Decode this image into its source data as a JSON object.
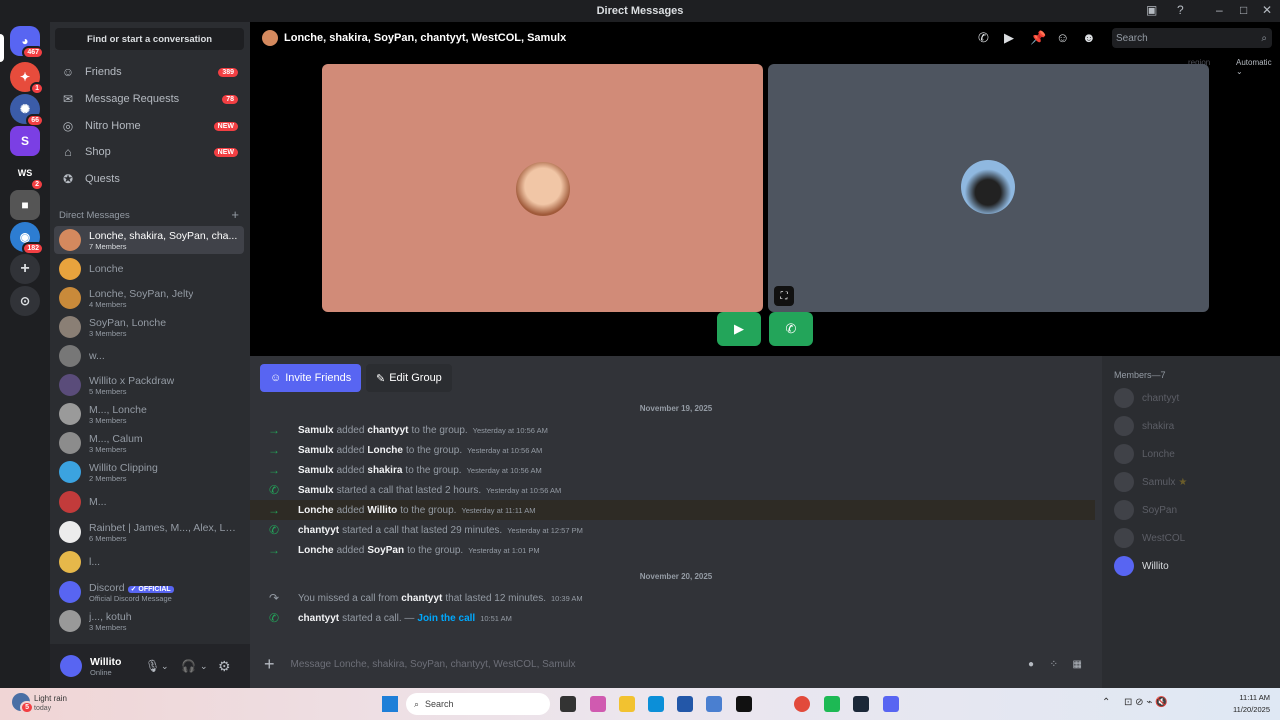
{
  "window": {
    "title": "Direct Messages"
  },
  "servers": {
    "home_badge": "467",
    "s1_badge": "1",
    "s2_badge": "66",
    "s4_label": "WS",
    "s4_badge": "2",
    "s6_badge": "182"
  },
  "sidebar": {
    "search": "Find or start a conversation",
    "nav": [
      {
        "label": "Friends",
        "badge": "389",
        "icon": "friends-icon"
      },
      {
        "label": "Message Requests",
        "badge": "78",
        "icon": "mail-icon"
      },
      {
        "label": "Nitro Home",
        "badge": "NEW",
        "icon": "nitro-icon"
      },
      {
        "label": "Shop",
        "badge": "NEW",
        "icon": "shop-icon"
      },
      {
        "label": "Quests",
        "badge": "",
        "icon": "quests-icon"
      }
    ],
    "dm_header": "Direct Messages",
    "dms": [
      {
        "name": "Lonche, shakira, SoyPan, cha...",
        "sub": "7 Members"
      },
      {
        "name": "Lonche",
        "sub": ""
      },
      {
        "name": "Lonche, SoyPan, Jelty",
        "sub": "4 Members"
      },
      {
        "name": "SoyPan, Lonche",
        "sub": "3 Members"
      },
      {
        "name": "w...",
        "sub": ""
      },
      {
        "name": "Willito x Packdraw",
        "sub": "5 Members"
      },
      {
        "name": "M..., Lonche",
        "sub": "3 Members"
      },
      {
        "name": "M..., Calum",
        "sub": "3 Members"
      },
      {
        "name": "Willito Clipping",
        "sub": "2 Members"
      },
      {
        "name": "M...",
        "sub": ""
      },
      {
        "name": "Rainbet | James, M..., Alex, Lo...",
        "sub": "6 Members"
      },
      {
        "name": "l...",
        "sub": ""
      },
      {
        "name": "Discord",
        "sub": "Official Discord Message",
        "tag": "OFFICIAL"
      },
      {
        "name": "j..., kotuh",
        "sub": "3 Members"
      }
    ],
    "user": {
      "name": "Willito",
      "status": "Online"
    }
  },
  "header": {
    "title": "Lonche, shakira, SoyPan, chantyyt, WestCOL, Samulx",
    "search_placeholder": "Search"
  },
  "call": {
    "region_label": "region",
    "region_value": "Automatic"
  },
  "chat": {
    "invite": "Invite Friends",
    "edit": "Edit Group",
    "date1": "November 19, 2025",
    "messages": [
      {
        "icon": "→",
        "user": "Samulx",
        "text": "added",
        "target": "chantyyt",
        "tail": "to the group.",
        "ts": "Yesterday at 10:56 AM"
      },
      {
        "icon": "→",
        "user": "Samulx",
        "text": "added",
        "target": "Lonche",
        "tail": "to the group.",
        "ts": "Yesterday at 10:56 AM"
      },
      {
        "icon": "→",
        "user": "Samulx",
        "text": "added",
        "target": "shakira",
        "tail": "to the group.",
        "ts": "Yesterday at 10:56 AM"
      },
      {
        "icon": "✆",
        "user": "Samulx",
        "text": "started a call that lasted 2 hours.",
        "target": "",
        "tail": "",
        "ts": "Yesterday at 10:56 AM"
      },
      {
        "icon": "→",
        "user": "Lonche",
        "text": "added",
        "target": "Willito",
        "tail": "to the group.",
        "ts": "Yesterday at 11:11 AM"
      },
      {
        "icon": "✆",
        "user": "chantyyt",
        "text": "started a call that lasted 29 minutes.",
        "target": "",
        "tail": "",
        "ts": "Yesterday at 12:57 PM"
      },
      {
        "icon": "→",
        "user": "Lonche",
        "text": "added",
        "target": "SoyPan",
        "tail": "to the group.",
        "ts": "Yesterday at 1:01 PM"
      }
    ],
    "date2": "November 20, 2025",
    "missed": {
      "pre": "You missed a call from",
      "user": "chantyyt",
      "post": "that lasted 12 minutes.",
      "ts": "10:39 AM"
    },
    "last": {
      "user": "chantyyt",
      "text": "started a call. —",
      "link": "Join the call",
      "ts": "10:51 AM"
    },
    "composer_placeholder": "Message Lonche, shakira, SoyPan, chantyyt, WestCOL, Samulx"
  },
  "members": {
    "header": "Members—7",
    "list": [
      "chantyyt",
      "shakira",
      "Lonche",
      "Samulx",
      "SoyPan",
      "WestCOL",
      "Willito"
    ]
  },
  "taskbar": {
    "weather": "Light rain",
    "weather_sub": "today",
    "weather_badge": "5",
    "search": "Search",
    "time": "11:11 AM",
    "date": "11/20/2025"
  }
}
